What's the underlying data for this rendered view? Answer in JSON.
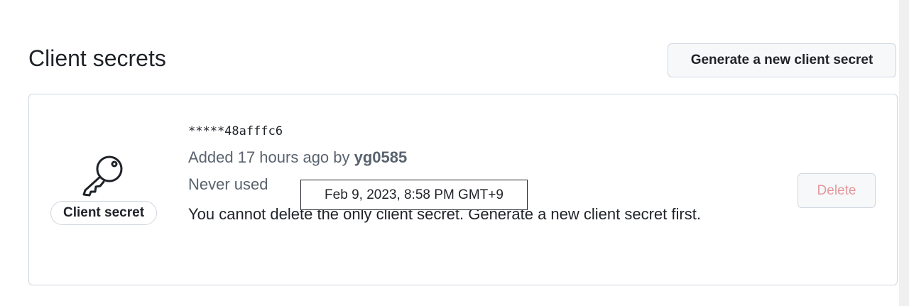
{
  "section": {
    "title": "Client secrets",
    "generate_button": "Generate a new client secret"
  },
  "secret": {
    "icon": "key-icon",
    "badge": "Client secret",
    "masked_value": "*****48afffc6",
    "added_prefix": "Added 17 hours ago by ",
    "added_by": "yg0585",
    "usage": "Never used",
    "warning": "You cannot delete the only client secret. Generate a new client secret first.",
    "delete_button": "Delete",
    "tooltip": "Feb 9, 2023, 8:58 PM GMT+9"
  },
  "colors": {
    "text": "#1f2328",
    "muted": "#59636e",
    "border": "#d0d7de",
    "button_bg": "#f6f8fa",
    "danger_disabled": "#e5989c"
  }
}
